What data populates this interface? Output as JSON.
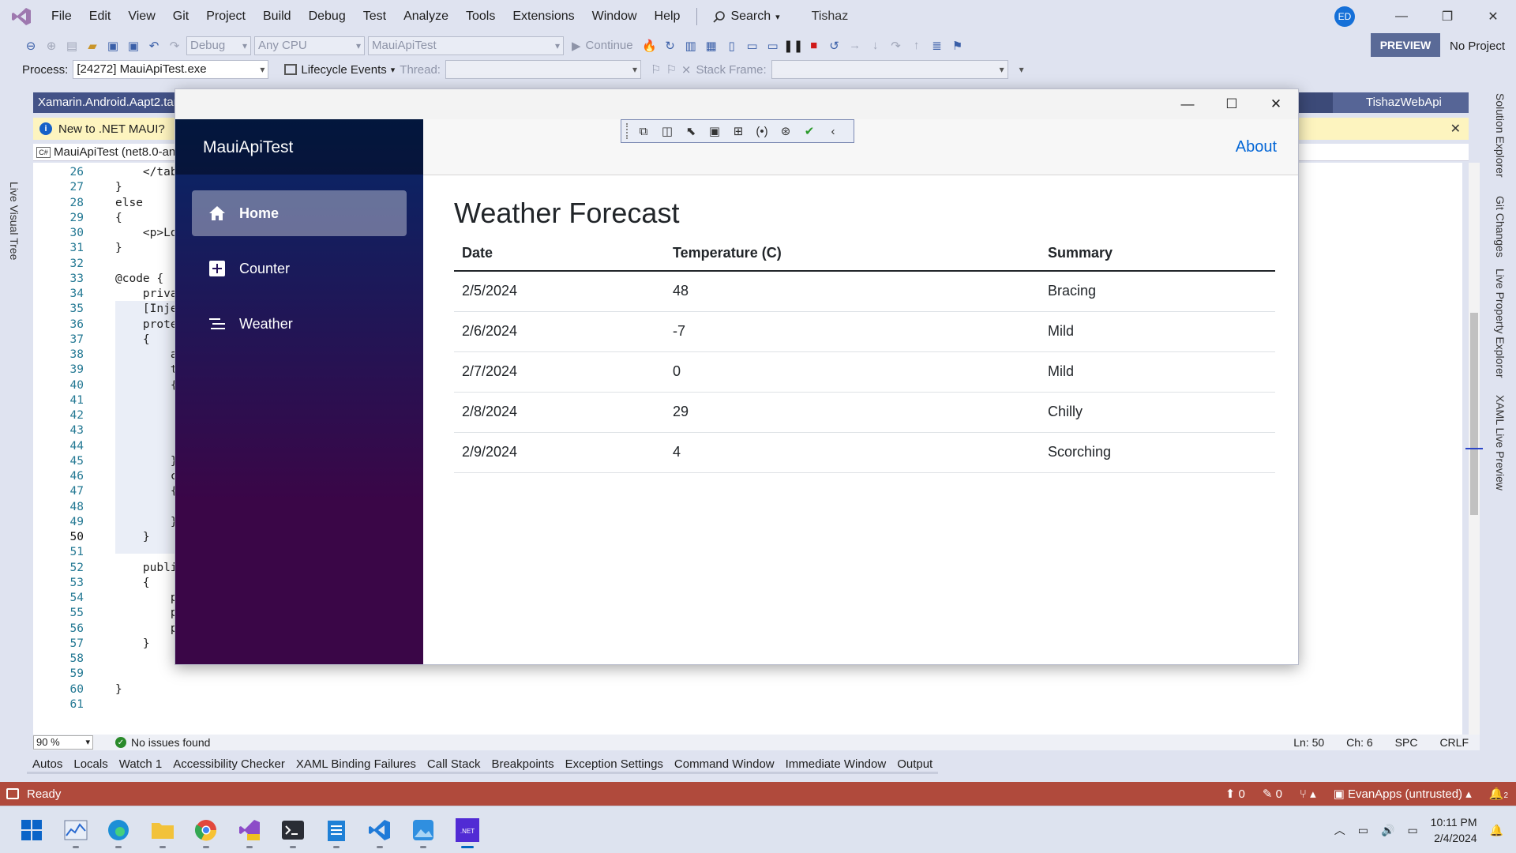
{
  "vs": {
    "menu": [
      "File",
      "Edit",
      "View",
      "Git",
      "Project",
      "Build",
      "Debug",
      "Test",
      "Analyze",
      "Tools",
      "Extensions",
      "Window",
      "Help"
    ],
    "search_label": "Search",
    "solution_name": "Tishaz",
    "avatar_initials": "ED",
    "toolbar": {
      "config": "Debug",
      "platform": "Any CPU",
      "startup_project": "MauiApiTest",
      "continue_label": "Continue",
      "preview_label": "PREVIEW",
      "no_project": "No Project"
    },
    "toolbar2": {
      "process_label": "Process:",
      "process_value": "[24272] MauiApiTest.exe",
      "lifecycle_label": "Lifecycle Events",
      "thread_label": "Thread:",
      "stack_frame_label": "Stack Frame:"
    },
    "left_vtab": "Live Visual Tree",
    "doc_tab": "Xamarin.Android.Aapt2.tar",
    "doc_tab_right": "TishazWebApi",
    "info_bar_text": "New to .NET MAUI?",
    "nav_project": "MauiApiTest (net8.0-an",
    "code_lines": [
      {
        "n": "26",
        "t": "    </tab"
      },
      {
        "n": "27",
        "t": "}"
      },
      {
        "n": "28",
        "t": "else"
      },
      {
        "n": "29",
        "t": "{"
      },
      {
        "n": "30",
        "t": "    <p>Lo"
      },
      {
        "n": "31",
        "t": "}"
      },
      {
        "n": "32",
        "t": ""
      },
      {
        "n": "33",
        "t": "@code {"
      },
      {
        "n": "34",
        "t": "    priva"
      },
      {
        "n": "35",
        "t": "    [Inje"
      },
      {
        "n": "36",
        "t": "    prote"
      },
      {
        "n": "37",
        "t": "    {"
      },
      {
        "n": "38",
        "t": "        a"
      },
      {
        "n": "39",
        "t": "        t"
      },
      {
        "n": "40",
        "t": "        {"
      },
      {
        "n": "41",
        "t": ""
      },
      {
        "n": "42",
        "t": ""
      },
      {
        "n": "43",
        "t": ""
      },
      {
        "n": "44",
        "t": ""
      },
      {
        "n": "45",
        "t": "        }"
      },
      {
        "n": "46",
        "t": "        c"
      },
      {
        "n": "47",
        "t": "        {"
      },
      {
        "n": "48",
        "t": ""
      },
      {
        "n": "49",
        "t": "        }"
      },
      {
        "n": "50",
        "t": "    }"
      },
      {
        "n": "51",
        "t": ""
      },
      {
        "n": "52",
        "t": "    publi"
      },
      {
        "n": "53",
        "t": "    {"
      },
      {
        "n": "54",
        "t": "        p"
      },
      {
        "n": "55",
        "t": "        p"
      },
      {
        "n": "56",
        "t": "        p"
      },
      {
        "n": "57",
        "t": "    }"
      },
      {
        "n": "58",
        "t": ""
      },
      {
        "n": "59",
        "t": ""
      },
      {
        "n": "60",
        "t": "}"
      },
      {
        "n": "61",
        "t": ""
      }
    ],
    "editor_status": {
      "zoom": "90 %",
      "issues": "No issues found",
      "ln": "Ln: 50",
      "ch": "Ch: 6",
      "spc": "SPC",
      "eol": "CRLF"
    },
    "tool_tabs": [
      "Autos",
      "Locals",
      "Watch 1",
      "Accessibility Checker",
      "XAML Binding Failures",
      "Call Stack",
      "Breakpoints",
      "Exception Settings",
      "Command Window",
      "Immediate Window",
      "Output"
    ],
    "status": {
      "ready": "Ready",
      "up_count": "0",
      "edit_count": "0",
      "repo": "EvanApps (untrusted)",
      "notifications": "2"
    },
    "right_vtabs": [
      "Solution Explorer",
      "Git Changes",
      "Live Property Explorer",
      "XAML Live Preview"
    ]
  },
  "app": {
    "brand": "MauiApiTest",
    "nav": [
      {
        "label": "Home",
        "icon": "home-icon",
        "active": true
      },
      {
        "label": "Counter",
        "icon": "plus-icon",
        "active": false
      },
      {
        "label": "Weather",
        "icon": "list-icon",
        "active": false
      }
    ],
    "about_link": "About",
    "page_title": "Weather Forecast",
    "table": {
      "headers": [
        "Date",
        "Temperature (C)",
        "Summary"
      ],
      "rows": [
        [
          "2/5/2024",
          "48",
          "Bracing"
        ],
        [
          "2/6/2024",
          "-7",
          "Mild"
        ],
        [
          "2/7/2024",
          "0",
          "Mild"
        ],
        [
          "2/8/2024",
          "29",
          "Chilly"
        ],
        [
          "2/9/2024",
          "4",
          "Scorching"
        ]
      ]
    }
  },
  "taskbar": {
    "apps": [
      "windows-start-icon",
      "performance-monitor-icon",
      "edge-icon",
      "file-explorer-icon",
      "chrome-icon",
      "visual-studio-preview-icon",
      "terminal-icon",
      "notepad-icon",
      "vscode-icon",
      "photos-icon",
      "dotnet-app-icon"
    ],
    "time": "10:11 PM",
    "date": "2/4/2024"
  },
  "colors": {
    "accent": "#5a6a97",
    "status_bar": "#b04a3c",
    "sidebar_top": "#052767",
    "sidebar_bottom": "#3a0647",
    "link": "#0366d6"
  }
}
